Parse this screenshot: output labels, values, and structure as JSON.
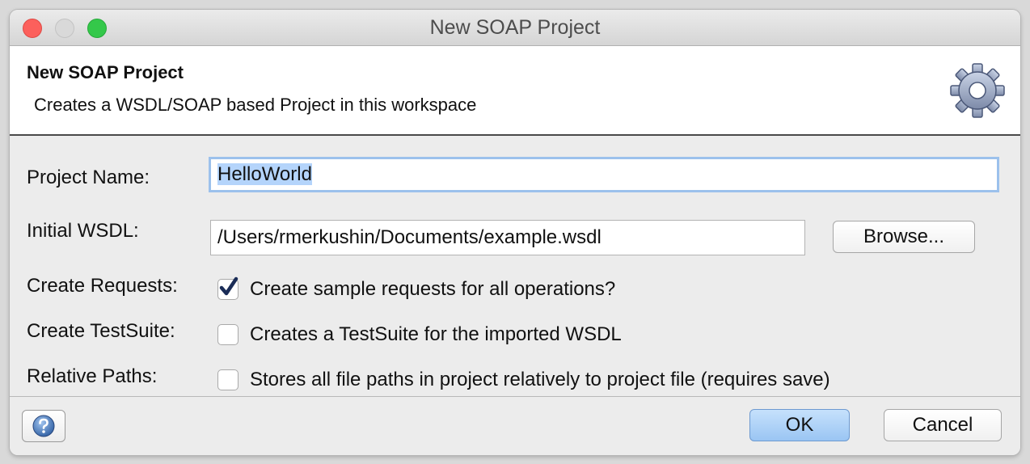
{
  "window": {
    "title": "New SOAP Project"
  },
  "header": {
    "title": "New SOAP Project",
    "description": "Creates a WSDL/SOAP based Project in this workspace",
    "icon": "gear-icon"
  },
  "form": {
    "project_name": {
      "label": "Project Name:",
      "value": "HelloWorld"
    },
    "initial_wsdl": {
      "label": "Initial WSDL:",
      "value": "/Users/rmerkushin/Documents/example.wsdl",
      "browse_label": "Browse..."
    },
    "create_requests": {
      "label": "Create Requests:",
      "checkbox_label": "Create sample requests for all operations?",
      "checked": true
    },
    "create_testsuite": {
      "label": "Create TestSuite:",
      "checkbox_label": "Creates a TestSuite for the imported WSDL",
      "checked": false
    },
    "relative_paths": {
      "label": "Relative Paths:",
      "checkbox_label": "Stores all file paths in project relatively to project file (requires save)",
      "checked": false
    }
  },
  "footer": {
    "ok_label": "OK",
    "cancel_label": "Cancel",
    "help_icon": "help-icon"
  },
  "colors": {
    "accent": "#9cc1ec",
    "selection": "#b4d4fb",
    "primary_button": "#9ac5f3",
    "close": "#fc605c",
    "maximize": "#34c84a"
  }
}
